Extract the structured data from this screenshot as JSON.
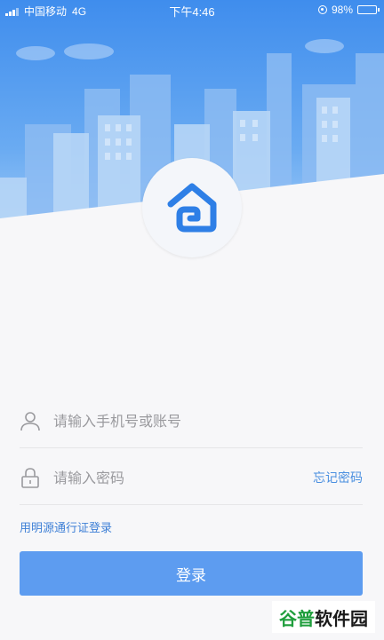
{
  "status_bar": {
    "carrier": "中国移动",
    "network": "4G",
    "time": "下午4:46",
    "battery": "98%"
  },
  "login": {
    "account_placeholder": "请输入手机号或账号",
    "password_placeholder": "请输入密码",
    "forgot_password": "忘记密码",
    "pass_login": "用明源通行证登录",
    "submit": "登录"
  },
  "watermark": {
    "part1": "谷普",
    "part2": "软件园"
  },
  "colors": {
    "accent": "#5d9cf0",
    "link": "#4a8fe0",
    "sky": "#4c99ee"
  },
  "icons": [
    "lock-rotation-icon",
    "battery-icon",
    "user-icon",
    "padlock-icon",
    "home-logo-icon"
  ]
}
